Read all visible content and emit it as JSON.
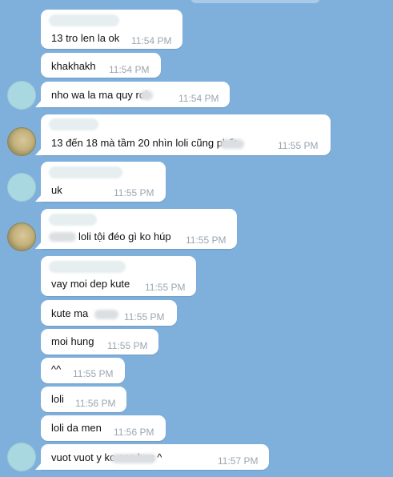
{
  "colors": {
    "background": "#7fb0dc",
    "bubble": "#ffffff",
    "time": "#9aa6b0"
  },
  "messages": [
    {
      "text": "13 tro len la ok",
      "time": "11:54 PM"
    },
    {
      "text": "khakhakh",
      "time": "11:54 PM"
    },
    {
      "text": "nho wa la ma quy    roi",
      "time": "11:54 PM"
    },
    {
      "text": "13 đến 18 mà tầm 20 nhìn loli cũng          phết",
      "time": "11:55 PM"
    },
    {
      "text": "uk",
      "time": "11:55 PM"
    },
    {
      "text": "loli tội đéo gì ko húp",
      "time": "11:55 PM"
    },
    {
      "text": "vay moi dep kute",
      "time": "11:55 PM"
    },
    {
      "text": "kute ma",
      "time": "11:55 PM"
    },
    {
      "text": "moi hung",
      "time": "11:55 PM"
    },
    {
      "text": "^^",
      "time": "11:55 PM"
    },
    {
      "text": "loli",
      "time": "11:56 PM"
    },
    {
      "text": "loli da men",
      "time": "11:56 PM"
    },
    {
      "text": "vuot vuot               y ko cac bac ^",
      "time": "11:57 PM"
    }
  ]
}
